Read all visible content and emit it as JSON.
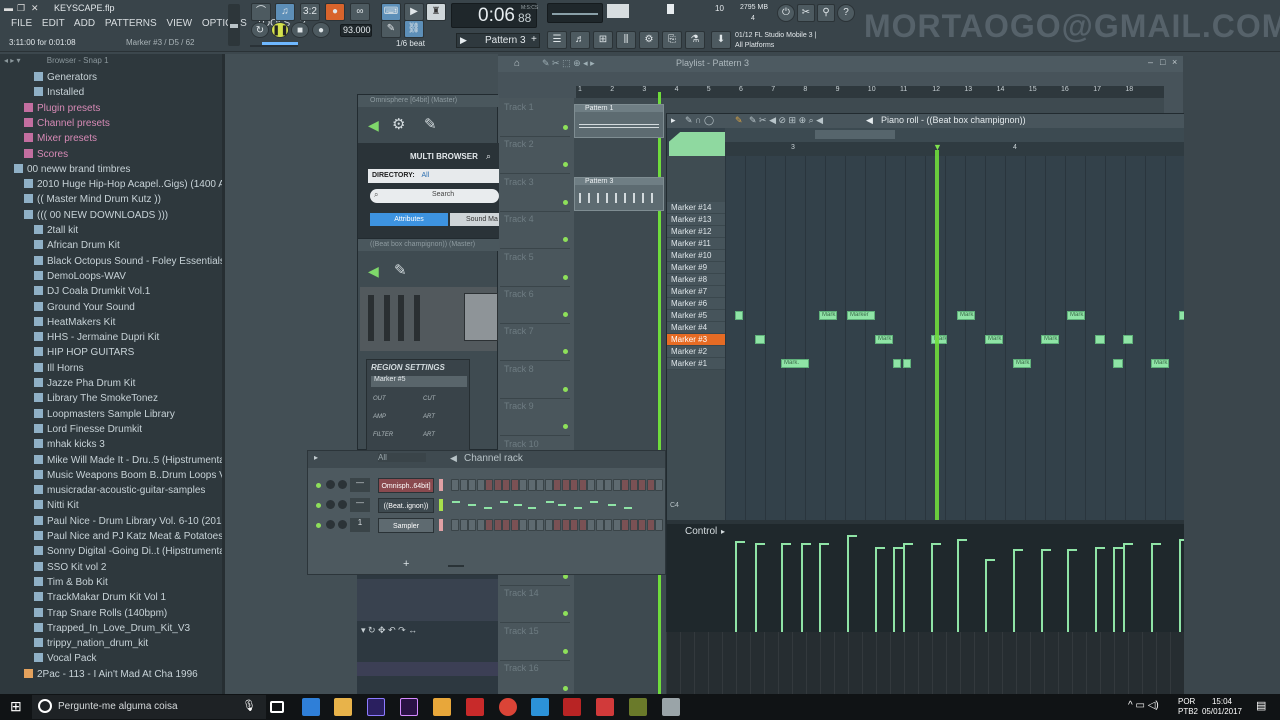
{
  "window": {
    "title": "KEYSCAPE.flp",
    "song_pos": "3:11:00 for 0:01:08",
    "marker_hint": "Marker #3 / D5 / 62"
  },
  "menu": [
    "FILE",
    "EDIT",
    "ADD",
    "PATTERNS",
    "VIEW",
    "OPTIONS",
    "TOOLS",
    "?"
  ],
  "transport": {
    "time": "0:06",
    "time_small": "88",
    "tempo": "93.000",
    "tempo_ms_label": "M:S:CS",
    "pattern": "Pattern 3",
    "snap": "1/6 beat",
    "cpu_value": "10",
    "mem": "2795 MB",
    "poly": "4"
  },
  "hint_bar": {
    "line1": "01/12  FL Studio Mobile 3 |",
    "line2": "All Platforms"
  },
  "watermark": "MORTAOGO@GMAIL.COM",
  "browser": {
    "title": "Browser - Snap 1",
    "items": [
      {
        "label": "Generators",
        "indent": 2,
        "type": "folder"
      },
      {
        "label": "Installed",
        "indent": 2,
        "type": "folder"
      },
      {
        "label": "Plugin presets",
        "indent": 1,
        "type": "preset"
      },
      {
        "label": "Channel presets",
        "indent": 1,
        "type": "preset"
      },
      {
        "label": "Mixer presets",
        "indent": 1,
        "type": "preset"
      },
      {
        "label": "Scores",
        "indent": 1,
        "type": "preset"
      },
      {
        "label": "00 neww brand timbres",
        "indent": 0,
        "type": "folder"
      },
      {
        "label": "2010 Huge Hip-Hop Acapel..Gigs) (1400 Acapellas)",
        "indent": 1,
        "type": "folder"
      },
      {
        "label": "(( Master Mind Drum Kutz ))",
        "indent": 1,
        "type": "folder"
      },
      {
        "label": "((( 00 NEW DOWNLOADS )))",
        "indent": 1,
        "type": "folder"
      },
      {
        "label": "2tall kit",
        "indent": 2,
        "type": "folder"
      },
      {
        "label": "African Drum Kit",
        "indent": 2,
        "type": "folder"
      },
      {
        "label": "Black Octopus Sound - Foley Essentials by AK",
        "indent": 2,
        "type": "folder"
      },
      {
        "label": "DemoLoops-WAV",
        "indent": 2,
        "type": "folder"
      },
      {
        "label": "DJ Coala Drumkit Vol.1",
        "indent": 2,
        "type": "folder"
      },
      {
        "label": "Ground Your Sound",
        "indent": 2,
        "type": "folder"
      },
      {
        "label": "HeatMakers Kit",
        "indent": 2,
        "type": "folder"
      },
      {
        "label": "HHS - Jermaine Dupri Kit",
        "indent": 2,
        "type": "folder"
      },
      {
        "label": "HIP HOP GUITARS",
        "indent": 2,
        "type": "folder"
      },
      {
        "label": "Ill Horns",
        "indent": 2,
        "type": "folder"
      },
      {
        "label": "Jazze Pha Drum Kit",
        "indent": 2,
        "type": "folder"
      },
      {
        "label": "Library The SmokeTonez",
        "indent": 2,
        "type": "folder"
      },
      {
        "label": "Loopmasters Sample Library",
        "indent": 2,
        "type": "folder"
      },
      {
        "label": "Lord Finesse Drumkit",
        "indent": 2,
        "type": "folder"
      },
      {
        "label": "mhak kicks 3",
        "indent": 2,
        "type": "folder"
      },
      {
        "label": "Mike Will Made It - Dru..5 (Hipstrumentals.com)",
        "indent": 2,
        "type": "folder"
      },
      {
        "label": "Music Weapons Boom B..Drum Loops Vol 1 WAV",
        "indent": 2,
        "type": "folder"
      },
      {
        "label": "musicradar-acoustic-guitar-samples",
        "indent": 2,
        "type": "folder"
      },
      {
        "label": "Nitti Kit",
        "indent": 2,
        "type": "folder"
      },
      {
        "label": "Paul Nice - Drum Library Vol. 6-10 (2013)",
        "indent": 2,
        "type": "folder"
      },
      {
        "label": "Paul Nice and PJ Katz Meat & Potatoes Vol 1 WAV",
        "indent": 2,
        "type": "folder"
      },
      {
        "label": "Sonny Digital -Going Di..t (Hipstrumentals.com)",
        "indent": 2,
        "type": "folder"
      },
      {
        "label": "SSO Kit vol 2",
        "indent": 2,
        "type": "folder"
      },
      {
        "label": "Tim & Bob Kit",
        "indent": 2,
        "type": "folder"
      },
      {
        "label": "TrackMakar Drum Kit Vol 1",
        "indent": 2,
        "type": "folder"
      },
      {
        "label": "Trap Snare Rolls (140bpm)",
        "indent": 2,
        "type": "folder"
      },
      {
        "label": "Trapped_In_Love_Drum_Kit_V3",
        "indent": 2,
        "type": "folder"
      },
      {
        "label": "trippy_nation_drum_kit",
        "indent": 2,
        "type": "folder"
      },
      {
        "label": "Vocal Pack",
        "indent": 2,
        "type": "folder"
      },
      {
        "label": "2Pac - 113 - I Ain't Mad At Cha 1996",
        "indent": 1,
        "type": "file"
      }
    ]
  },
  "playlist": {
    "title": "Playlist - Pattern 3",
    "ruler": [
      "1",
      "2",
      "3",
      "4",
      "5",
      "6",
      "7",
      "8",
      "9",
      "10",
      "11",
      "12",
      "13",
      "14",
      "15",
      "16",
      "17",
      "18"
    ],
    "tracks": [
      "Track 1",
      "Track 2",
      "Track 3",
      "Track 4",
      "Track 5",
      "Track 6",
      "Track 7",
      "Track 8",
      "Track 9",
      "Track 10",
      "Track 11",
      "Track 12",
      "Track 13",
      "Track 14",
      "Track 15",
      "Track 16"
    ],
    "clips": [
      "Pattern 1",
      "Pattern 3"
    ]
  },
  "omnisphere": {
    "title": "Omnisphere [64bit] (Master)",
    "header": "MULTI BROWSER",
    "directory_label": "DIRECTORY:",
    "directory_value": "All",
    "search": "Search",
    "tab1": "Attributes",
    "tab2": "Sound Ma"
  },
  "beatbox": {
    "title": "((Beat box champignon)) (Master)",
    "region": "REGION SETTINGS",
    "region_value": "Marker #5",
    "row_labels": [
      "OUT",
      "CUT",
      "AMP",
      "ART",
      "FILTER",
      "ART",
      "SHAPE"
    ]
  },
  "piano_roll": {
    "title": "Piano roll - ((Beat box champignon))",
    "ruler": [
      "3",
      "4",
      "5"
    ],
    "markers": [
      "Marker #14",
      "Marker #13",
      "Marker #12",
      "Marker #11",
      "Marker #10",
      "Marker #9",
      "Marker #8",
      "Marker #7",
      "Marker #6",
      "Marker #5",
      "Marker #4",
      "Marker #3",
      "Marker #2",
      "Marker #1"
    ],
    "selected_marker": "Marker #3",
    "c4_label": "C4",
    "control_label": "Control",
    "note_label": "Mark.",
    "note_label_long": "Marker #5",
    "note_label_long2": "Marker #1"
  },
  "channel_rack": {
    "title": "Channel rack",
    "filter": "All",
    "channels": [
      {
        "name": "Omnisph..64bit]",
        "num": "—"
      },
      {
        "name": "((Beat..ignon))",
        "num": "—"
      },
      {
        "name": "Sampler",
        "num": "1"
      }
    ],
    "add_button": "+"
  },
  "taskbar": {
    "search_placeholder": "Pergunte-me alguma coisa",
    "lang1": "POR",
    "lang2": "PTB2",
    "time": "15:04",
    "date": "05/01/2017"
  },
  "colors": {
    "accent_green": "#8fe4a6",
    "selected_orange": "#e66b24",
    "playhead": "#6fdc3c"
  }
}
